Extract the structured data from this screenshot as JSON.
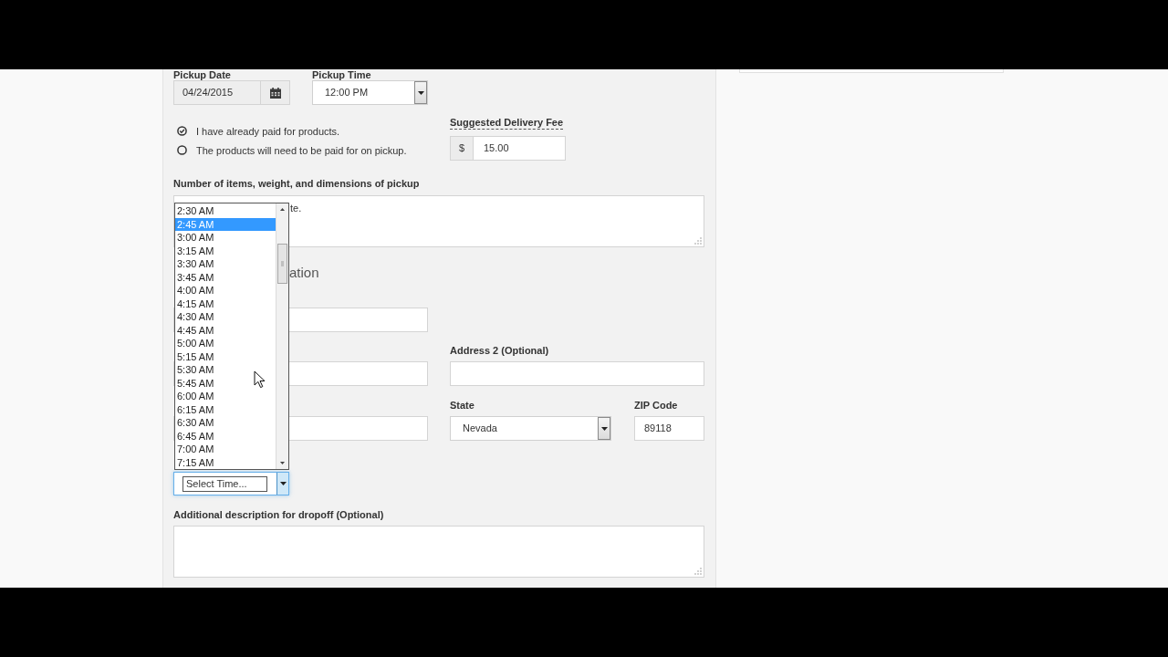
{
  "pickup": {
    "date": {
      "label": "Pickup Date",
      "value": "04/24/2015"
    },
    "time": {
      "label": "Pickup Time",
      "value": "12:00 PM"
    }
  },
  "payment_options": [
    {
      "label": "I have already paid for products.",
      "selected": true
    },
    {
      "label": "The products will need to be paid for on pickup.",
      "selected": false
    }
  ],
  "delivery_fee": {
    "label": "Suggested Delivery Fee",
    "currency": "$",
    "value": "15.00"
  },
  "items_description": {
    "label": "Number of items, weight, and dimensions of pickup",
    "value": "te."
  },
  "dropoff": {
    "heading": "ation",
    "address_2": {
      "label": "Address 2 (Optional)"
    },
    "state": {
      "label": "State",
      "value": "Nevada"
    },
    "zip": {
      "label": "ZIP Code",
      "value": "89118"
    },
    "time_select": {
      "value": "Select Time...",
      "focused": true,
      "expanded": true,
      "options": [
        {
          "label": "2:30 AM",
          "selected": false
        },
        {
          "label": "2:45 AM",
          "selected": true
        },
        {
          "label": "3:00 AM",
          "selected": false
        },
        {
          "label": "3:15 AM",
          "selected": false
        },
        {
          "label": "3:30 AM",
          "selected": false
        },
        {
          "label": "3:45 AM",
          "selected": false
        },
        {
          "label": "4:00 AM",
          "selected": false
        },
        {
          "label": "4:15 AM",
          "selected": false
        },
        {
          "label": "4:30 AM",
          "selected": false
        },
        {
          "label": "4:45 AM",
          "selected": false
        },
        {
          "label": "5:00 AM",
          "selected": false
        },
        {
          "label": "5:15 AM",
          "selected": false
        },
        {
          "label": "5:30 AM",
          "selected": false
        },
        {
          "label": "5:45 AM",
          "selected": false
        },
        {
          "label": "6:00 AM",
          "selected": false
        },
        {
          "label": "6:15 AM",
          "selected": false
        },
        {
          "label": "6:30 AM",
          "selected": false
        },
        {
          "label": "6:45 AM",
          "selected": false
        },
        {
          "label": "7:00 AM",
          "selected": false
        },
        {
          "label": "7:15 AM",
          "selected": false
        }
      ]
    },
    "description": {
      "label": "Additional description for dropoff (Optional)"
    }
  }
}
